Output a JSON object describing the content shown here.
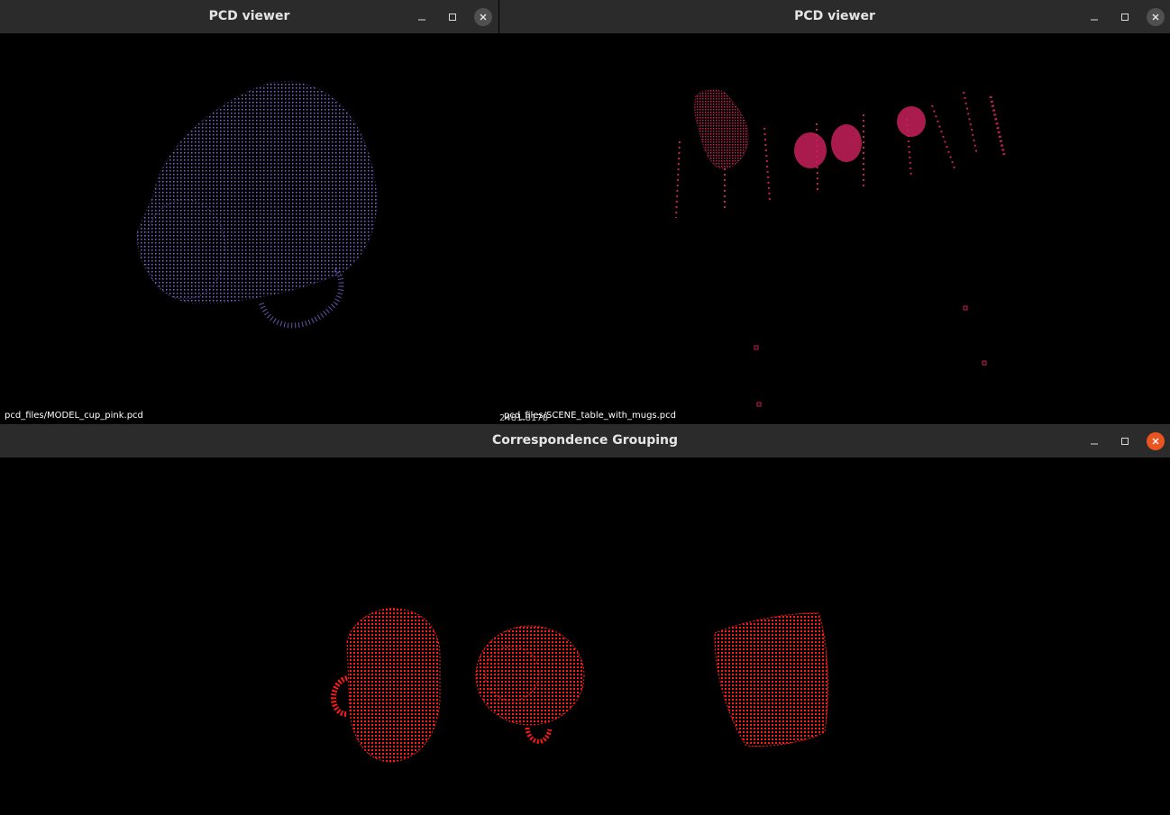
{
  "windows": {
    "model_viewer": {
      "title": "PCD viewer",
      "file_label": "pcd_files/MODEL_cup_pink.pcd",
      "point_color": "#7b6bd6"
    },
    "scene_viewer": {
      "title": "PCD viewer",
      "file_label": "pcd_files/SCENE_table_with_mugs.pcd",
      "overlay_label": "2481.8178",
      "point_color": "#c8205a"
    },
    "correspondence": {
      "title": "Correspondence Grouping",
      "point_color": "#ff1a1a"
    }
  },
  "controls": {
    "minimize_icon": "minimize-icon",
    "maximize_icon": "maximize-icon",
    "close_icon": "close-icon"
  }
}
